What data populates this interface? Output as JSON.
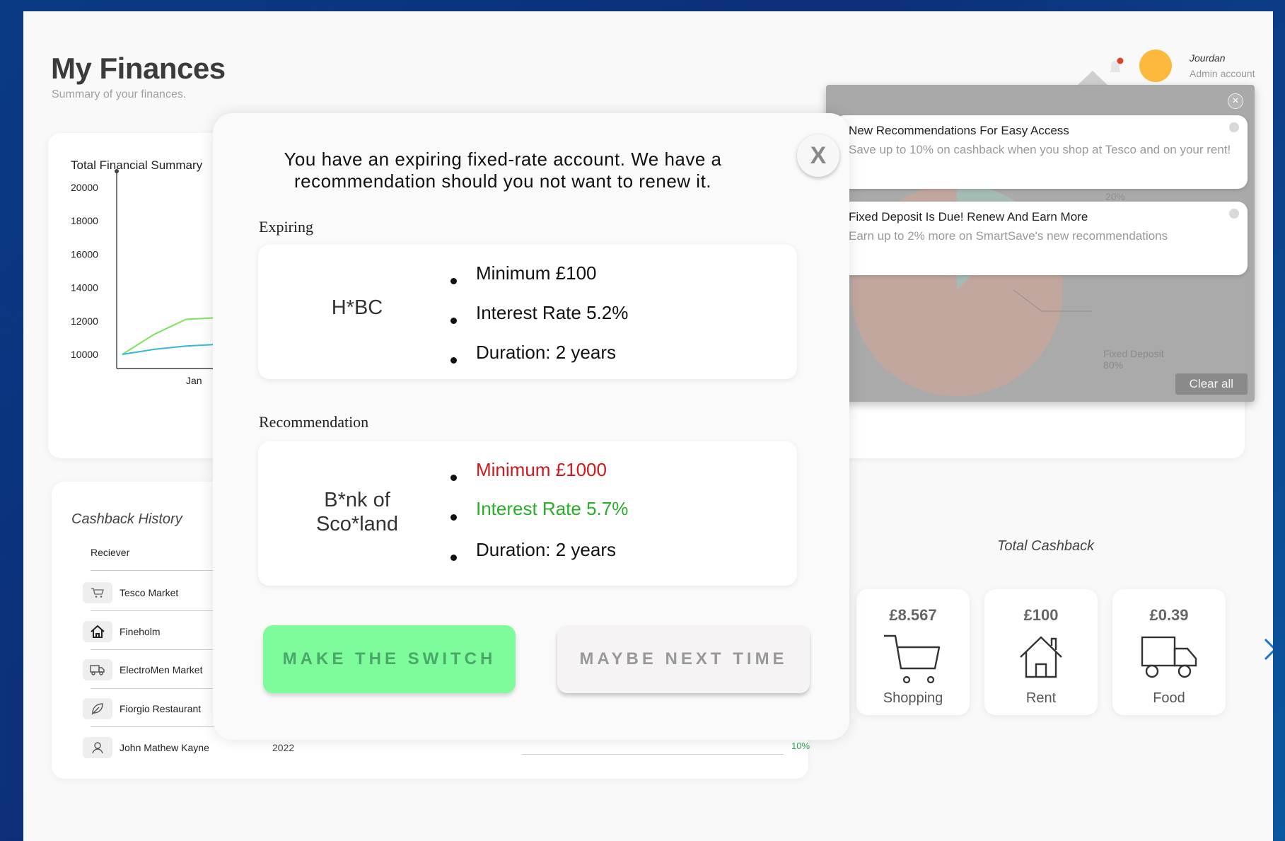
{
  "header": {
    "title": "My Finances",
    "subtitle": "Summary of your finances.",
    "user_name": "Jourdan",
    "user_role": "Admin account"
  },
  "financial_summary": {
    "title": "Total Financial Summary",
    "chart_data": {
      "type": "line",
      "title": "Total Financial Summary",
      "yticks": [
        20000,
        18000,
        16000,
        14000,
        12000,
        10000
      ],
      "xticks": [
        "Jan"
      ],
      "series": [
        {
          "color": "#7ee35c",
          "values": [
            10000,
            11200,
            12100,
            12200
          ]
        },
        {
          "color": "#35b8d8",
          "values": [
            10000,
            10300,
            10500,
            10600
          ]
        }
      ]
    },
    "pie_labels": {
      "slice_small_pct": "20%",
      "slice_large_name": "Fixed Deposit",
      "slice_large_pct": "80%"
    }
  },
  "cashback": {
    "title": "Cashback History",
    "column_receiver": "Reciever",
    "rows": [
      {
        "name": "Tesco Market",
        "icon": "cart-icon"
      },
      {
        "name": "Fineholm",
        "icon": "home-icon"
      },
      {
        "name": "ElectroMen Market",
        "icon": "truck-icon"
      },
      {
        "name": "Fiorgio Restaurant",
        "icon": "leaf-icon"
      },
      {
        "name": "John Mathew Kayne",
        "icon": "user-icon"
      }
    ],
    "last_year": "2022",
    "last_pct": "10%"
  },
  "total_cashback": {
    "title": "Total Cashback",
    "tiles": [
      {
        "amount": "£8.567",
        "label": "Shopping",
        "icon": "cart-icon"
      },
      {
        "amount": "£100",
        "label": "Rent",
        "icon": "house-icon"
      },
      {
        "amount": "£0.39",
        "label": "Food",
        "icon": "truck-icon"
      }
    ]
  },
  "notifications": {
    "items": [
      {
        "title": "New Recommendations For Easy Access",
        "body": "Save up to 10% on cashback when you shop at Tesco and on your rent!"
      },
      {
        "title": "Fixed Deposit Is Due! Renew And Earn More",
        "body": "Earn up to 2% more on SmartSave's new recommendations"
      }
    ],
    "clear_all": "Clear all"
  },
  "modal": {
    "close_label": "X",
    "title": "You have an expiring fixed-rate account. We have a recommendation should you not want to renew it.",
    "expiring_label": "Expiring",
    "expiring": {
      "bank": "H*BC",
      "details": [
        "Minimum £100",
        "Interest Rate 5.2%",
        "Duration: 2 years"
      ]
    },
    "recommendation_label": "Recommendation",
    "recommendation": {
      "bank": "B*nk of Sco*land",
      "details": [
        "Minimum £1000",
        "Interest Rate 5.7%",
        "Duration: 2 years"
      ],
      "colors": [
        "#d0181b",
        "#2aae2a",
        "#111111"
      ]
    },
    "primary_button": "MAKE THE SWITCH",
    "secondary_button": "MAYBE NEXT TIME"
  },
  "colors": {
    "accent_green": "#7efb9b",
    "avatar": "#fdb93d",
    "notification_dot": "#e0412e"
  }
}
